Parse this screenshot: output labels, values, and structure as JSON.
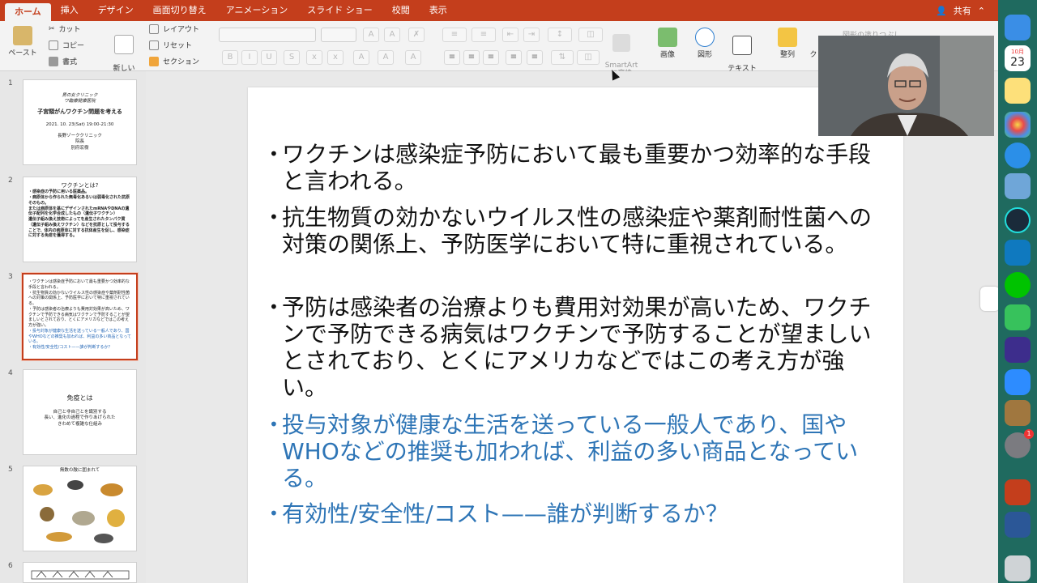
{
  "ribbon": {
    "tabs": [
      "ホーム",
      "挿入",
      "デザイン",
      "画面切り替え",
      "アニメーション",
      "スライド ショー",
      "校閲",
      "表示"
    ],
    "share_label": "共有"
  },
  "toolbar": {
    "paste": "ペースト",
    "cut": "カット",
    "copy": "コピー",
    "format": "書式",
    "new_slide": "新しい\nスライド",
    "layout": "レイアウト",
    "reset": "リセット",
    "section": "セクション",
    "smartart": "SmartArt\nに変換",
    "image": "画像",
    "shape": "図形",
    "textbox": "テキスト\nボックス",
    "arrange": "整列",
    "quick_style": "ク",
    "shape_fill": "図形の塗りつぶし"
  },
  "thumbnails": [
    {
      "num": "1",
      "lines": [
        "男の女クリニック",
        "ワ臨療健康医院",
        "子宮頸がんワクチン問題を考える",
        "2021. 10. 23(Sat)    19:00-21:30",
        "長野ゾーククリニック",
        "院長",
        "別府宏樹"
      ]
    },
    {
      "num": "2",
      "title": "ワクチンとは?",
      "body": "・感染症の予防に用いる医薬品。\n・病原体から作られた無毒化あるいは弱毒化された抗原そのもの。\nまたは病原体を基にデザインされたmRNAやDNAの遺伝子配列を化学合成したもの（遺伝子ワクチン）\n遺伝子組み換え技術によってを産生されたタンパク質（遺伝子組み換えワクチン）などを抗原として投与することで、体内の病原体に対する抗体産生を促し、感染症に対する免疫を獲得する。"
    },
    {
      "num": "3",
      "body": "・ワクチンは感染症予防において最も重要かつ効率的な手段と言われる。\n・抗生物質の効かないウイルス性の感染症や薬剤耐性菌への対策の関係上、予防医学において特に重視されている。\n・予防は感染者の治療よりも費用対効果が高いため、ワクチンで予防できる病気はワクチンで予防することが望ましいとされており、とくにアメリカなどではこの考え方が強い。",
      "blue": "・投与対象が健康な生活を送っている一般人であり、国やWHOなどの推奨も加われば、利益の多い商品となっている。\n・有効性/安全性/コスト——誰が判断するか？"
    },
    {
      "num": "4",
      "title": "免疫とは",
      "sub": "自己と非自己とを識別する\n長い、進化の過程で作りあげられた\nきわめて複雑な仕組み"
    },
    {
      "num": "5",
      "title": "無数の敵に囲まれて"
    },
    {
      "num": "6"
    }
  ],
  "slide": {
    "bullets": [
      {
        "text": "ワクチンは感染症予防において最も重要かつ効率的な手段と言われる。"
      },
      {
        "text": "抗生物質の効かないウイルス性の感染症や薬剤耐性菌への対策の関係上、予防医学において特に重視されている。"
      },
      {
        "text": "予防は感染者の治療よりも費用対効果が高いため、ワクチンで予防できる病気はワクチンで予防することが望ましいとされており、とくにアメリカなどではこの考え方が強い。"
      },
      {
        "text": "投与対象が健康な生活を送っている一般人であり、国やWHOなどの推奨も加われば、利益の多い商品となっている。"
      },
      {
        "text": "有効性/安全性/コスト——誰が判断するか？"
      }
    ]
  },
  "dock": {
    "calendar_month": "10月",
    "calendar_day": "23",
    "notification_badge": "1"
  },
  "colors": {
    "ribbon": "#c43e1c",
    "accent_text": "#2e75b6",
    "dock": "#1f6a5f"
  }
}
